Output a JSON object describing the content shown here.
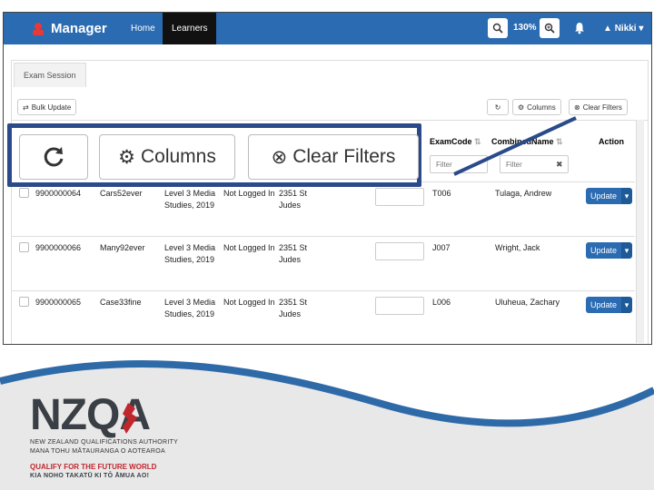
{
  "navbar": {
    "brand": "Manager",
    "links": [
      "Home",
      "Learners"
    ],
    "zoom": "130%",
    "user": "Nikki"
  },
  "panel": {
    "tab": "Exam Session",
    "bulk_update": "Bulk Update",
    "columns": "Columns",
    "clear_filters": "Clear Filters"
  },
  "grid": {
    "headers": {
      "exam_code": "ExamCode",
      "combined_name": "CombinedName",
      "action": "Action"
    },
    "filter_placeholder": "Filter",
    "rows": [
      {
        "nsn": "9900000064",
        "user": "Cars52ever",
        "standard": "Level 3 Media Studies, 2019",
        "status": "Not Logged In",
        "location": "2351 St Judes",
        "code": "T006",
        "name": "Tulaga, Andrew",
        "action": "Update"
      },
      {
        "nsn": "9900000066",
        "user": "Many92ever",
        "standard": "Level 3 Media Studies, 2019",
        "status": "Not Logged In",
        "location": "2351 St Judes",
        "code": "J007",
        "name": "Wright, Jack",
        "action": "Update"
      },
      {
        "nsn": "9900000065",
        "user": "Case33fine",
        "standard": "Level 3 Media Studies, 2019",
        "status": "Not Logged In",
        "location": "2351 St Judes",
        "code": "L006",
        "name": "Uluheua, Zachary",
        "action": "Update"
      }
    ]
  },
  "callout": {
    "columns": "Columns",
    "clear_filters": "Clear Filters"
  },
  "footer": {
    "logo": "NZQA",
    "line1": "NEW ZEALAND QUALIFICATIONS AUTHORITY",
    "line2": "MANA TOHU MĀTAURANGA O AOTEAROA",
    "line3": "QUALIFY FOR THE FUTURE WORLD",
    "line4": "KIA NOHO TAKATŪ KI TŌ ĀMUA AO!"
  },
  "colors": {
    "nav": "#2a6bb2",
    "callout_border": "#2a4a8a",
    "wave": "#2f6aa8",
    "nzqa_accent": "#c0272d"
  }
}
